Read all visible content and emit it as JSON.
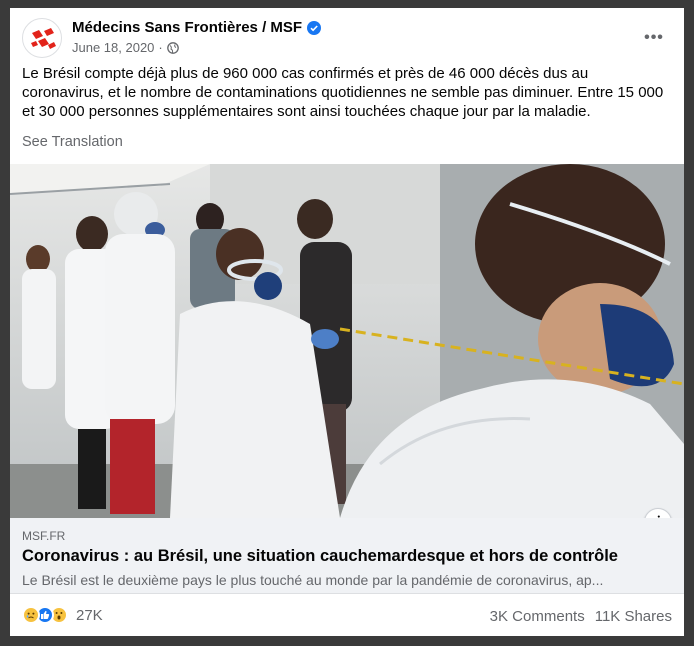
{
  "post": {
    "author": "Médecins Sans Frontières / MSF",
    "date": "June 18, 2020",
    "text": "Le Brésil compte déjà plus de 960 000 cas confirmés et près de 46 000 décès dus au coronavirus, et le nombre de contaminations quotidiennes ne semble pas diminuer. Entre 15 000 et 30 000 personnes supplémentaires sont ainsi touchées chaque jour par la maladie.",
    "see_translation": "See Translation",
    "more_label": "•••"
  },
  "link": {
    "domain": "MSF.FR",
    "title": "Coronavirus : au Brésil, une situation cauchemardesque et hors de contrôle",
    "description": "Le Brésil est le deuxième pays le plus touché au monde par la pandémie de coronavirus, ap...",
    "info_label": "i"
  },
  "engagement": {
    "reaction_count": "27K",
    "comments": "3K Comments",
    "shares": "11K Shares",
    "reactions": [
      "sad-icon",
      "like-icon",
      "wow-icon"
    ]
  },
  "colors": {
    "accent": "#1877f2",
    "msf_red": "#e2231a",
    "secondary_text": "#65676b",
    "link_bg": "#f0f2f5"
  }
}
